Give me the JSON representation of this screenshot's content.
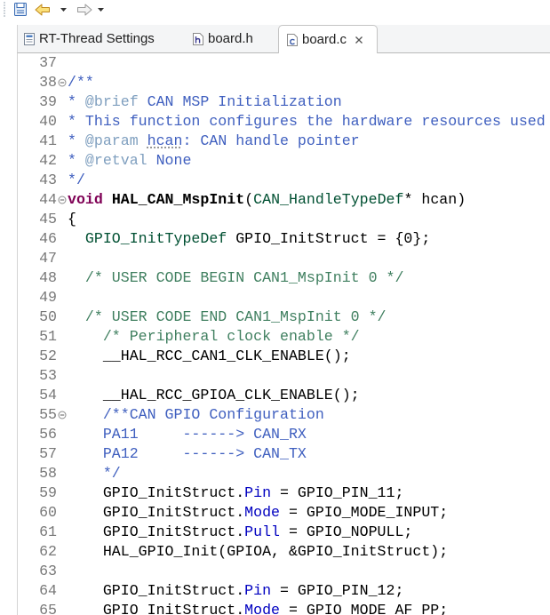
{
  "toolbar": {
    "icons": [
      "toolbar-grip-icon",
      "save-icon",
      "back-arrow-icon",
      "chevron-down-icon",
      "forward-arrow-icon",
      "chevron-down-icon"
    ]
  },
  "tabs": [
    {
      "label": "RT-Thread Settings",
      "icon": "settings-file-icon",
      "active": false
    },
    {
      "label": "board.h",
      "icon": "header-file-icon",
      "active": false
    },
    {
      "label": "board.c",
      "icon": "c-file-icon",
      "active": true,
      "close_icon": "close-icon"
    }
  ],
  "editor": {
    "lines": [
      {
        "n": "37",
        "t": []
      },
      {
        "n": "38",
        "fold": true,
        "t": [
          {
            "text": "/**",
            "color": "#3F5FBF"
          }
        ]
      },
      {
        "n": "39",
        "t": [
          {
            "text": "* ",
            "color": "#3F5FBF"
          },
          {
            "text": "@brief",
            "color": "#7F9FBF"
          },
          {
            "text": " CAN MSP Initialization",
            "color": "#3F5FBF"
          }
        ]
      },
      {
        "n": "40",
        "t": [
          {
            "text": "* This function configures the hardware resources used",
            "color": "#3F5FBF"
          }
        ]
      },
      {
        "n": "41",
        "t": [
          {
            "text": "* ",
            "color": "#3F5FBF"
          },
          {
            "text": "@param",
            "color": "#7F9FBF"
          },
          {
            "text": " ",
            "color": "#3F5FBF"
          },
          {
            "text": "hcan",
            "color": "#3F5FBF",
            "underline": true
          },
          {
            "text": ": CAN handle pointer",
            "color": "#3F5FBF"
          }
        ]
      },
      {
        "n": "42",
        "t": [
          {
            "text": "* ",
            "color": "#3F5FBF"
          },
          {
            "text": "@retval",
            "color": "#7F9FBF"
          },
          {
            "text": " None",
            "color": "#3F5FBF"
          }
        ]
      },
      {
        "n": "43",
        "t": [
          {
            "text": "*/",
            "color": "#3F5FBF"
          }
        ]
      },
      {
        "n": "44",
        "fold": true,
        "t": [
          {
            "text": "void",
            "color": "#7F0055",
            "bold": true
          },
          {
            "text": " "
          },
          {
            "text": "HAL_CAN_MspInit",
            "bold": true
          },
          {
            "text": "("
          },
          {
            "text": "CAN_HandleTypeDef",
            "color": "#005032"
          },
          {
            "text": "* hcan)"
          }
        ]
      },
      {
        "n": "45",
        "t": [
          {
            "text": "{"
          }
        ]
      },
      {
        "n": "46",
        "t": [
          {
            "text": "  "
          },
          {
            "text": "GPIO_InitTypeDef",
            "color": "#005032"
          },
          {
            "text": " GPIO_InitStruct = {0};"
          }
        ]
      },
      {
        "n": "47",
        "t": []
      },
      {
        "n": "48",
        "t": [
          {
            "text": "  "
          },
          {
            "text": "/* USER CODE BEGIN CAN1_MspInit 0 */",
            "color": "#3F7F5F"
          }
        ]
      },
      {
        "n": "49",
        "t": []
      },
      {
        "n": "50",
        "t": [
          {
            "text": "  "
          },
          {
            "text": "/* USER CODE END CAN1_MspInit 0 */",
            "color": "#3F7F5F"
          }
        ]
      },
      {
        "n": "51",
        "t": [
          {
            "text": "    "
          },
          {
            "text": "/* Peripheral clock enable */",
            "color": "#3F7F5F"
          }
        ]
      },
      {
        "n": "52",
        "t": [
          {
            "text": "    __HAL_RCC_CAN1_CLK_ENABLE();"
          }
        ]
      },
      {
        "n": "53",
        "t": []
      },
      {
        "n": "54",
        "t": [
          {
            "text": "    __HAL_RCC_GPIOA_CLK_ENABLE();"
          }
        ]
      },
      {
        "n": "55",
        "fold": true,
        "t": [
          {
            "text": "    "
          },
          {
            "text": "/**CAN GPIO Configuration",
            "color": "#3F5FBF"
          }
        ]
      },
      {
        "n": "56",
        "t": [
          {
            "text": "    PA11     ------> CAN_RX",
            "color": "#3F5FBF"
          }
        ]
      },
      {
        "n": "57",
        "t": [
          {
            "text": "    PA12     ------> CAN_TX",
            "color": "#3F5FBF"
          }
        ]
      },
      {
        "n": "58",
        "t": [
          {
            "text": "    */",
            "color": "#3F5FBF"
          }
        ]
      },
      {
        "n": "59",
        "t": [
          {
            "text": "    GPIO_InitStruct."
          },
          {
            "text": "Pin",
            "color": "#0000C0"
          },
          {
            "text": " = GPIO_PIN_11;"
          }
        ]
      },
      {
        "n": "60",
        "t": [
          {
            "text": "    GPIO_InitStruct."
          },
          {
            "text": "Mode",
            "color": "#0000C0"
          },
          {
            "text": " = GPIO_MODE_INPUT;"
          }
        ]
      },
      {
        "n": "61",
        "t": [
          {
            "text": "    GPIO_InitStruct."
          },
          {
            "text": "Pull",
            "color": "#0000C0"
          },
          {
            "text": " = GPIO_NOPULL;"
          }
        ]
      },
      {
        "n": "62",
        "t": [
          {
            "text": "    HAL_GPIO_Init(GPIOA, &GPIO_InitStruct);"
          }
        ]
      },
      {
        "n": "63",
        "t": []
      },
      {
        "n": "64",
        "t": [
          {
            "text": "    GPIO_InitStruct."
          },
          {
            "text": "Pin",
            "color": "#0000C0"
          },
          {
            "text": " = GPIO_PIN_12;"
          }
        ]
      },
      {
        "n": "65",
        "t": [
          {
            "text": "    GPIO_InitStruct."
          },
          {
            "text": "Mode",
            "color": "#0000C0"
          },
          {
            "text": " = GPIO_MODE_AF_PP;"
          }
        ]
      }
    ]
  }
}
